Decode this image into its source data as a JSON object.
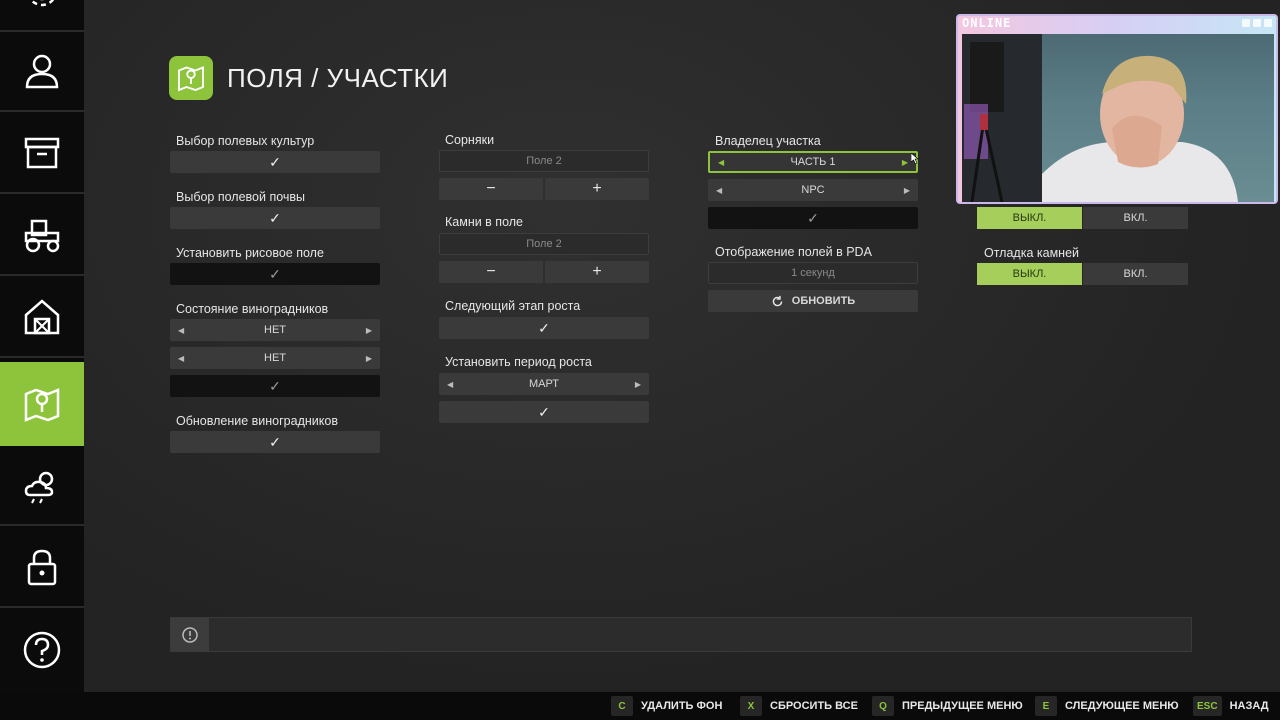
{
  "page": {
    "title": "ПОЛЯ / УЧАСТКИ"
  },
  "col1": {
    "crops_label": "Выбор полевых культур",
    "soil_label": "Выбор полевой почвы",
    "rice_label": "Установить рисовое поле",
    "vineyard_state_label": "Состояние виноградников",
    "vineyard_sel1": "НЕТ",
    "vineyard_sel2": "НЕТ",
    "vineyard_update_label": "Обновление виноградников"
  },
  "col2": {
    "weeds_label": "Сорняки",
    "weeds_value": "Поле 2",
    "stones_label": "Камни в поле",
    "stones_value": "Поле 2",
    "growth_stage_label": "Следующий этап роста",
    "growth_period_label": "Установить период роста",
    "growth_period_value": "МАРТ"
  },
  "col3": {
    "owner_label": "Владелец участка",
    "owner_part": "ЧАСТЬ 1",
    "owner_npc": "NPC",
    "pda_label": "Отображение полей в PDA",
    "pda_value": "1 секунд",
    "refresh_label": "ОБНОВИТЬ"
  },
  "col4": {
    "toggle1_off": "ВЫКЛ.",
    "toggle1_on": "ВКЛ.",
    "stones_debug_label": "Отладка камней",
    "toggle2_off": "ВЫКЛ.",
    "toggle2_on": "ВКЛ."
  },
  "check": "✓",
  "minus": "−",
  "plus": "+",
  "webcam": {
    "title": "ONLINE"
  },
  "hotkeys": [
    {
      "key": "C",
      "label": "УДАЛИТЬ ФОН"
    },
    {
      "key": "X",
      "label": "СБРОСИТЬ ВСЕ"
    },
    {
      "key": "Q",
      "label": "ПРЕДЫДУЩЕЕ МЕНЮ"
    },
    {
      "key": "E",
      "label": "СЛЕДУЮЩЕЕ МЕНЮ"
    },
    {
      "key": "ESC",
      "label": "НАЗАД"
    }
  ],
  "sidebar": {
    "icons": [
      "settings-icon",
      "user-icon",
      "archive-box-icon",
      "tractor-icon",
      "barn-icon",
      "map-pin-icon",
      "weather-icon",
      "lock-icon",
      "help-icon"
    ],
    "active": "map-pin-icon"
  },
  "colors": {
    "accent": "#8dc43c",
    "toggle_on": "#a5cf5a",
    "sidebar_bg": "#0b0b0b",
    "panel_bg": "#262626"
  }
}
